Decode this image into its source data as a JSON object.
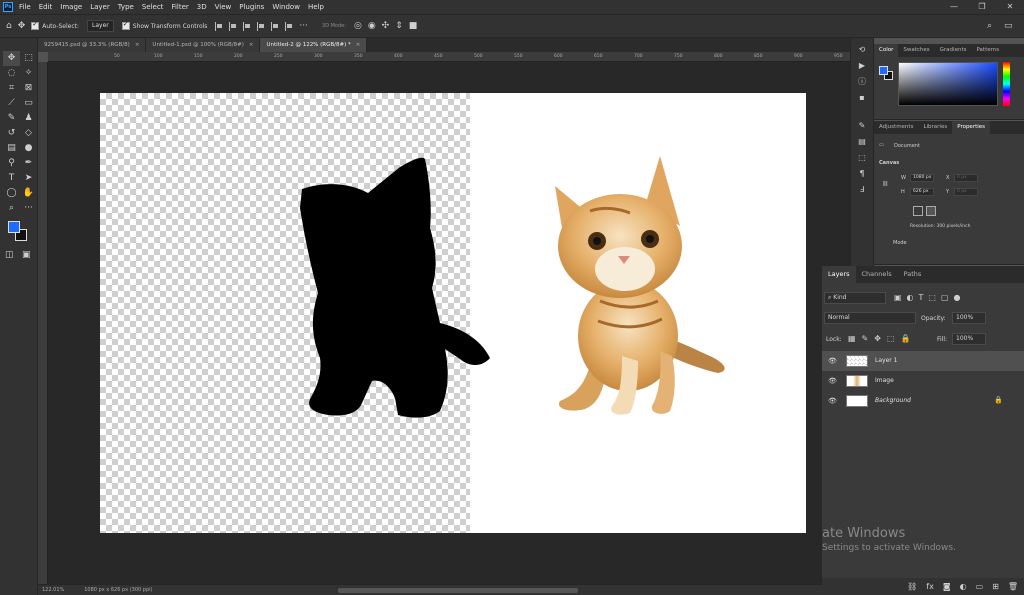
{
  "app": {
    "logo": "Ps",
    "window_controls": [
      "—",
      "❐",
      "✕"
    ]
  },
  "menu": [
    "File",
    "Edit",
    "Image",
    "Layer",
    "Type",
    "Select",
    "Filter",
    "3D",
    "View",
    "Plugins",
    "Window",
    "Help"
  ],
  "options_bar": {
    "auto_select_label": "Auto-Select:",
    "auto_select_value": "Layer",
    "transform_label": "Show Transform Controls",
    "mode_3d": "3D Mode:"
  },
  "tabs": [
    {
      "label": "9259415.psd @ 33.3% (RGB/8)"
    },
    {
      "label": "Untitled-1.psd @ 100% (RGB/8#)"
    },
    {
      "label": "Untitled-2 @ 122% (RGB/8#) *"
    }
  ],
  "ruler_ticks": [
    "50",
    "100",
    "150",
    "200",
    "250",
    "300",
    "350",
    "400",
    "450",
    "500",
    "550",
    "600",
    "650",
    "700",
    "750",
    "800",
    "850",
    "900",
    "950"
  ],
  "status": {
    "zoom": "122.01%",
    "doc_size": "1080 px x 626 px (300 ppi)"
  },
  "color_panel": {
    "tabs": [
      "Color",
      "Swatches",
      "Gradients",
      "Patterns"
    ],
    "fg": "#1e6bff",
    "bg": "#111111"
  },
  "properties_panel": {
    "tabs": [
      "Adjustments",
      "Libraries",
      "Properties"
    ],
    "document_label": "Document",
    "canvas_label": "Canvas",
    "w_label": "W",
    "w_value": "1080 px",
    "h_label": "H",
    "h_value": "626 px",
    "x_label": "X",
    "x_value": "0 px",
    "y_label": "Y",
    "y_value": "0 px",
    "resolution": "Resolution: 300 pixels/inch",
    "mode_label": "Mode"
  },
  "layers_panel": {
    "tabs": [
      "Layers",
      "Channels",
      "Paths"
    ],
    "kind_label": "Kind",
    "blend_mode": "Normal",
    "opacity_label": "Opacity:",
    "opacity_value": "100%",
    "lock_label": "Lock:",
    "fill_label": "Fill:",
    "fill_value": "100%",
    "layers": [
      {
        "name": "Layer 1",
        "selected": true
      },
      {
        "name": "Image",
        "selected": false
      },
      {
        "name": "Background",
        "selected": false
      }
    ]
  },
  "watermark": {
    "line1": "ate Windows",
    "line2": "Settings to activate Windows."
  }
}
